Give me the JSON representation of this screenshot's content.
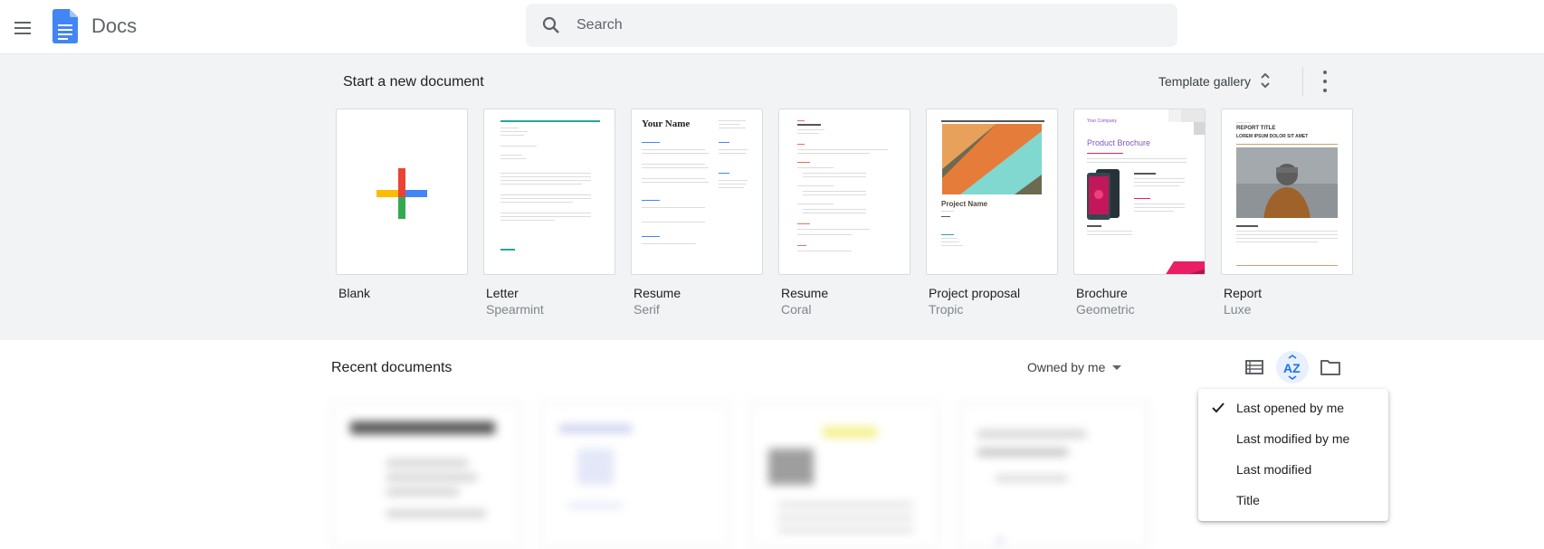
{
  "header": {
    "app_name": "Docs",
    "search_placeholder": "Search"
  },
  "templates": {
    "title": "Start a new document",
    "gallery_label": "Template gallery",
    "items": [
      {
        "name": "Blank",
        "sub": ""
      },
      {
        "name": "Letter",
        "sub": "Spearmint"
      },
      {
        "name": "Resume",
        "sub": "Serif"
      },
      {
        "name": "Resume",
        "sub": "Coral"
      },
      {
        "name": "Project proposal",
        "sub": "Tropic"
      },
      {
        "name": "Brochure",
        "sub": "Geometric"
      },
      {
        "name": "Report",
        "sub": "Luxe"
      }
    ],
    "thumb_text": {
      "resume_serif_name": "Your Name",
      "proposal_name": "Project Name",
      "brochure_company": "Your Company",
      "brochure_title": "Product Brochure",
      "report_title": "REPORT TITLE",
      "report_sub": "LOREM IPSUM DOLOR SIT AMET"
    }
  },
  "recent": {
    "title": "Recent documents",
    "owner_filter": "Owned by me"
  },
  "sort_menu": {
    "selected": "Last opened by me",
    "options": [
      "Last opened by me",
      "Last modified by me",
      "Last modified",
      "Title"
    ]
  },
  "colors": {
    "accent": "#1a73e8",
    "template_bg": "#f1f3f4",
    "sort_active_bg": "#e8f0fe"
  }
}
